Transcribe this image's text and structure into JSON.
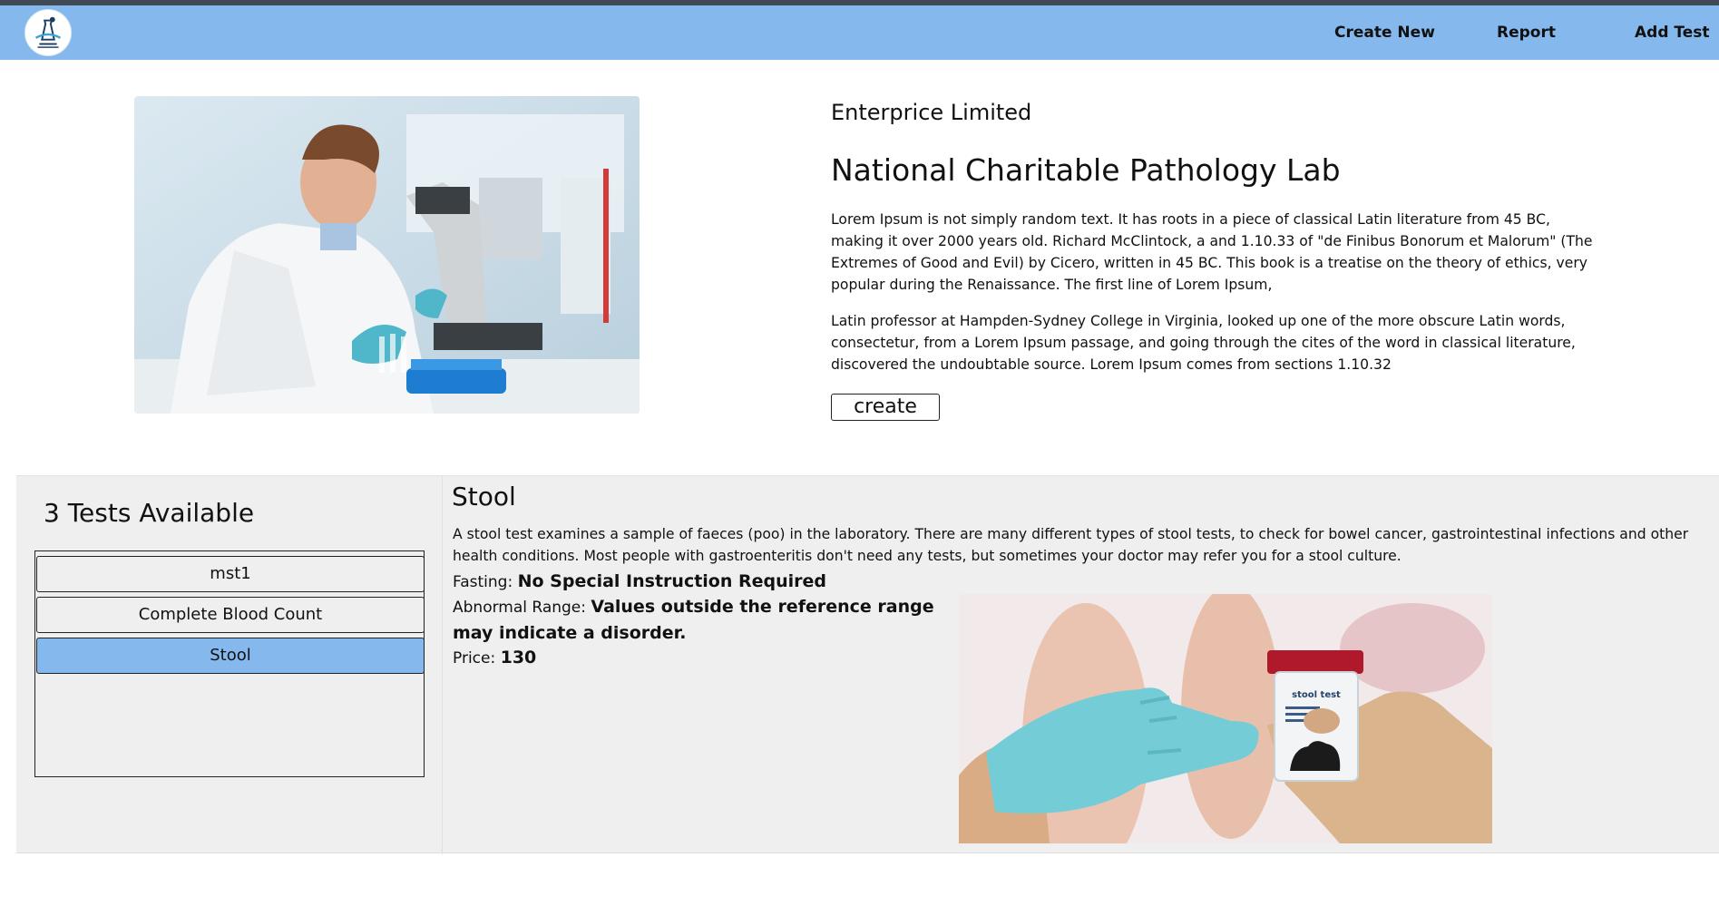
{
  "nav": {
    "logo_icon": "lab-logo-icon",
    "links": [
      "Create New",
      "Report",
      "Add Test"
    ]
  },
  "hero": {
    "image_icon": "scientist-microscope-photo",
    "company": "Enterprice Limited",
    "title": "National Charitable Pathology Lab",
    "paragraph1": "Lorem Ipsum is not simply random text. It has roots in a piece of classical Latin literature from 45 BC, making it over 2000 years old. Richard McClintock, a and 1.10.33 of \"de Finibus Bonorum et Malorum\" (The Extremes of Good and Evil) by Cicero, written in 45 BC. This book is a treatise on the theory of ethics, very popular during the Renaissance. The first line of Lorem Ipsum,",
    "paragraph2": "Latin professor at Hampden-Sydney College in Virginia, looked up one of the more obscure Latin words, consectetur, from a Lorem Ipsum passage, and going through the cites of the word in classical literature, discovered the undoubtable source. Lorem Ipsum comes from sections 1.10.32",
    "create_label": "create"
  },
  "tests": {
    "count_label": "3 Tests Available",
    "items": [
      "mst1",
      "Complete Blood Count",
      "Stool"
    ],
    "selected_index": 2
  },
  "detail": {
    "title": "Stool",
    "description": "A stool test examines a sample of faeces (poo) in the laboratory. There are many different types of stool tests, to check for bowel cancer, gastrointestinal infections and other health conditions. Most people with gastroenteritis don't need any tests, but sometimes your doctor may refer you for a stool culture.",
    "fasting_label": "Fasting:",
    "fasting_value": "No Special Instruction Required",
    "abnormal_label": "Abnormal Range:",
    "abnormal_value": "Values outside the reference range may indicate a disorder.",
    "price_label": "Price:",
    "price_value": "130",
    "image_icon": "stool-test-illustration",
    "image_jar_label": "stool test"
  },
  "colors": {
    "navbar": "#85b9ee",
    "top_strip": "#3f4a54",
    "panel_bg": "#efefef",
    "selected_item": "#85b9ee"
  }
}
